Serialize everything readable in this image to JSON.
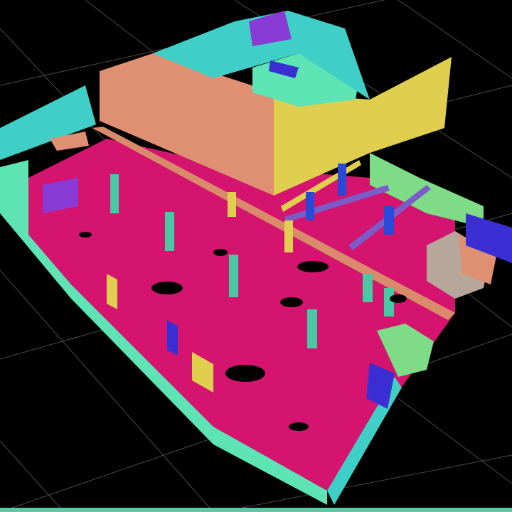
{
  "viewer": {
    "background": "#000000",
    "grid_color": "#4a4a4a",
    "bottom_bar_color": "#5ec9a6"
  },
  "palette": {
    "floor": "#d4146e",
    "wall_mint": "#5de3b4",
    "wall_peach": "#e09072",
    "wall_yellow": "#e0cf4e",
    "wall_teal": "#3fcfc6",
    "wall_green": "#7edc86",
    "wall_blue": "#3b2fd3",
    "wall_purple": "#8a3bd6",
    "wall_gray": "#b7a69a",
    "pillar_teal": "#48c9a4",
    "pipe_orange": "#d88a6a",
    "pipe_purple": "#7b5cc9",
    "column_blue": "#2a49d9"
  }
}
